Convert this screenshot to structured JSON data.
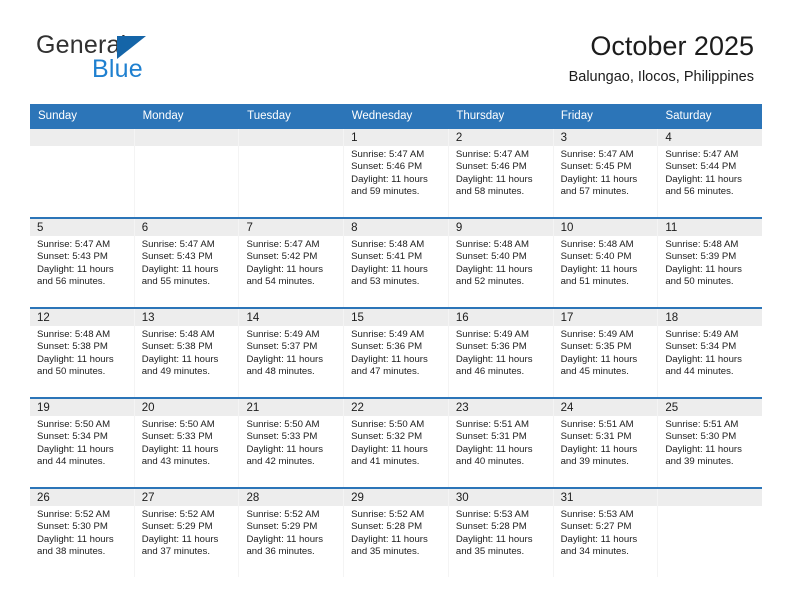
{
  "brand": {
    "name_top": "General",
    "name_bottom": "Blue",
    "triangle_color": "#1565a8",
    "blue_color": "#1f80d0"
  },
  "header": {
    "title": "October 2025",
    "subtitle": "Balungao, Ilocos, Philippines"
  },
  "theme": {
    "header_band": "#2c75b8",
    "day_number_band": "#ededed",
    "text": "#1c1c1c"
  },
  "weekdays": [
    "Sunday",
    "Monday",
    "Tuesday",
    "Wednesday",
    "Thursday",
    "Friday",
    "Saturday"
  ],
  "weeks": [
    [
      {
        "day": "",
        "sunrise": "",
        "sunset": "",
        "daylight_line1": "",
        "daylight_line2": "",
        "empty": true
      },
      {
        "day": "",
        "sunrise": "",
        "sunset": "",
        "daylight_line1": "",
        "daylight_line2": "",
        "empty": true
      },
      {
        "day": "",
        "sunrise": "",
        "sunset": "",
        "daylight_line1": "",
        "daylight_line2": "",
        "empty": true
      },
      {
        "day": "1",
        "sunrise": "Sunrise: 5:47 AM",
        "sunset": "Sunset: 5:46 PM",
        "daylight_line1": "Daylight: 11 hours",
        "daylight_line2": "and 59 minutes."
      },
      {
        "day": "2",
        "sunrise": "Sunrise: 5:47 AM",
        "sunset": "Sunset: 5:46 PM",
        "daylight_line1": "Daylight: 11 hours",
        "daylight_line2": "and 58 minutes."
      },
      {
        "day": "3",
        "sunrise": "Sunrise: 5:47 AM",
        "sunset": "Sunset: 5:45 PM",
        "daylight_line1": "Daylight: 11 hours",
        "daylight_line2": "and 57 minutes."
      },
      {
        "day": "4",
        "sunrise": "Sunrise: 5:47 AM",
        "sunset": "Sunset: 5:44 PM",
        "daylight_line1": "Daylight: 11 hours",
        "daylight_line2": "and 56 minutes."
      }
    ],
    [
      {
        "day": "5",
        "sunrise": "Sunrise: 5:47 AM",
        "sunset": "Sunset: 5:43 PM",
        "daylight_line1": "Daylight: 11 hours",
        "daylight_line2": "and 56 minutes."
      },
      {
        "day": "6",
        "sunrise": "Sunrise: 5:47 AM",
        "sunset": "Sunset: 5:43 PM",
        "daylight_line1": "Daylight: 11 hours",
        "daylight_line2": "and 55 minutes."
      },
      {
        "day": "7",
        "sunrise": "Sunrise: 5:47 AM",
        "sunset": "Sunset: 5:42 PM",
        "daylight_line1": "Daylight: 11 hours",
        "daylight_line2": "and 54 minutes."
      },
      {
        "day": "8",
        "sunrise": "Sunrise: 5:48 AM",
        "sunset": "Sunset: 5:41 PM",
        "daylight_line1": "Daylight: 11 hours",
        "daylight_line2": "and 53 minutes."
      },
      {
        "day": "9",
        "sunrise": "Sunrise: 5:48 AM",
        "sunset": "Sunset: 5:40 PM",
        "daylight_line1": "Daylight: 11 hours",
        "daylight_line2": "and 52 minutes."
      },
      {
        "day": "10",
        "sunrise": "Sunrise: 5:48 AM",
        "sunset": "Sunset: 5:40 PM",
        "daylight_line1": "Daylight: 11 hours",
        "daylight_line2": "and 51 minutes."
      },
      {
        "day": "11",
        "sunrise": "Sunrise: 5:48 AM",
        "sunset": "Sunset: 5:39 PM",
        "daylight_line1": "Daylight: 11 hours",
        "daylight_line2": "and 50 minutes."
      }
    ],
    [
      {
        "day": "12",
        "sunrise": "Sunrise: 5:48 AM",
        "sunset": "Sunset: 5:38 PM",
        "daylight_line1": "Daylight: 11 hours",
        "daylight_line2": "and 50 minutes."
      },
      {
        "day": "13",
        "sunrise": "Sunrise: 5:48 AM",
        "sunset": "Sunset: 5:38 PM",
        "daylight_line1": "Daylight: 11 hours",
        "daylight_line2": "and 49 minutes."
      },
      {
        "day": "14",
        "sunrise": "Sunrise: 5:49 AM",
        "sunset": "Sunset: 5:37 PM",
        "daylight_line1": "Daylight: 11 hours",
        "daylight_line2": "and 48 minutes."
      },
      {
        "day": "15",
        "sunrise": "Sunrise: 5:49 AM",
        "sunset": "Sunset: 5:36 PM",
        "daylight_line1": "Daylight: 11 hours",
        "daylight_line2": "and 47 minutes."
      },
      {
        "day": "16",
        "sunrise": "Sunrise: 5:49 AM",
        "sunset": "Sunset: 5:36 PM",
        "daylight_line1": "Daylight: 11 hours",
        "daylight_line2": "and 46 minutes."
      },
      {
        "day": "17",
        "sunrise": "Sunrise: 5:49 AM",
        "sunset": "Sunset: 5:35 PM",
        "daylight_line1": "Daylight: 11 hours",
        "daylight_line2": "and 45 minutes."
      },
      {
        "day": "18",
        "sunrise": "Sunrise: 5:49 AM",
        "sunset": "Sunset: 5:34 PM",
        "daylight_line1": "Daylight: 11 hours",
        "daylight_line2": "and 44 minutes."
      }
    ],
    [
      {
        "day": "19",
        "sunrise": "Sunrise: 5:50 AM",
        "sunset": "Sunset: 5:34 PM",
        "daylight_line1": "Daylight: 11 hours",
        "daylight_line2": "and 44 minutes."
      },
      {
        "day": "20",
        "sunrise": "Sunrise: 5:50 AM",
        "sunset": "Sunset: 5:33 PM",
        "daylight_line1": "Daylight: 11 hours",
        "daylight_line2": "and 43 minutes."
      },
      {
        "day": "21",
        "sunrise": "Sunrise: 5:50 AM",
        "sunset": "Sunset: 5:33 PM",
        "daylight_line1": "Daylight: 11 hours",
        "daylight_line2": "and 42 minutes."
      },
      {
        "day": "22",
        "sunrise": "Sunrise: 5:50 AM",
        "sunset": "Sunset: 5:32 PM",
        "daylight_line1": "Daylight: 11 hours",
        "daylight_line2": "and 41 minutes."
      },
      {
        "day": "23",
        "sunrise": "Sunrise: 5:51 AM",
        "sunset": "Sunset: 5:31 PM",
        "daylight_line1": "Daylight: 11 hours",
        "daylight_line2": "and 40 minutes."
      },
      {
        "day": "24",
        "sunrise": "Sunrise: 5:51 AM",
        "sunset": "Sunset: 5:31 PM",
        "daylight_line1": "Daylight: 11 hours",
        "daylight_line2": "and 39 minutes."
      },
      {
        "day": "25",
        "sunrise": "Sunrise: 5:51 AM",
        "sunset": "Sunset: 5:30 PM",
        "daylight_line1": "Daylight: 11 hours",
        "daylight_line2": "and 39 minutes."
      }
    ],
    [
      {
        "day": "26",
        "sunrise": "Sunrise: 5:52 AM",
        "sunset": "Sunset: 5:30 PM",
        "daylight_line1": "Daylight: 11 hours",
        "daylight_line2": "and 38 minutes."
      },
      {
        "day": "27",
        "sunrise": "Sunrise: 5:52 AM",
        "sunset": "Sunset: 5:29 PM",
        "daylight_line1": "Daylight: 11 hours",
        "daylight_line2": "and 37 minutes."
      },
      {
        "day": "28",
        "sunrise": "Sunrise: 5:52 AM",
        "sunset": "Sunset: 5:29 PM",
        "daylight_line1": "Daylight: 11 hours",
        "daylight_line2": "and 36 minutes."
      },
      {
        "day": "29",
        "sunrise": "Sunrise: 5:52 AM",
        "sunset": "Sunset: 5:28 PM",
        "daylight_line1": "Daylight: 11 hours",
        "daylight_line2": "and 35 minutes."
      },
      {
        "day": "30",
        "sunrise": "Sunrise: 5:53 AM",
        "sunset": "Sunset: 5:28 PM",
        "daylight_line1": "Daylight: 11 hours",
        "daylight_line2": "and 35 minutes."
      },
      {
        "day": "31",
        "sunrise": "Sunrise: 5:53 AM",
        "sunset": "Sunset: 5:27 PM",
        "daylight_line1": "Daylight: 11 hours",
        "daylight_line2": "and 34 minutes."
      },
      {
        "day": "",
        "sunrise": "",
        "sunset": "",
        "daylight_line1": "",
        "daylight_line2": "",
        "empty": true
      }
    ]
  ]
}
